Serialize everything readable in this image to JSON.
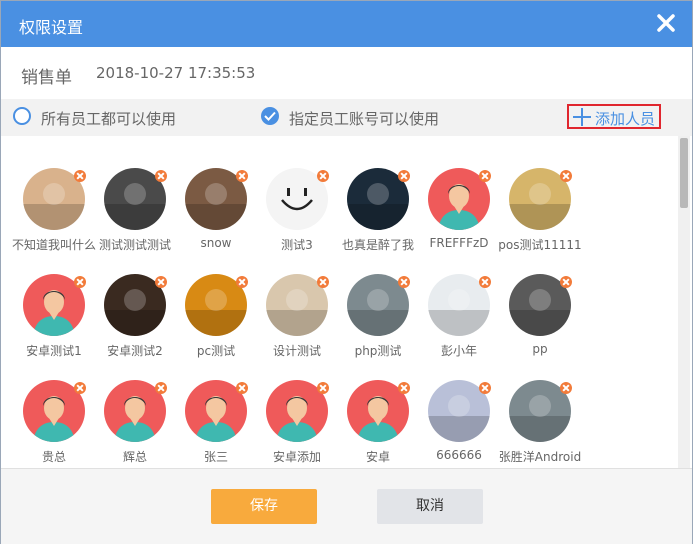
{
  "dialog": {
    "title": "权限设置",
    "close_icon": "close-icon",
    "accent": "#4a90e2"
  },
  "document": {
    "type": "销售单",
    "timestamp": "2018-10-27 17:35:53"
  },
  "options": {
    "all_employees": {
      "label": "所有员工都可以使用",
      "checked": false
    },
    "specified_employees": {
      "label": "指定员工账号可以使用",
      "checked": true
    },
    "add_member": {
      "label": "添加人员",
      "icon": "plus-icon"
    }
  },
  "members": [
    {
      "name": "不知道我叫什么",
      "avatar": "photo-crying-kid",
      "color": "#d9b28c"
    },
    {
      "name": "测试测试测试",
      "avatar": "photo-keyboard",
      "color": "#4a4a4a"
    },
    {
      "name": "snow",
      "avatar": "photo-bearded-man",
      "color": "#7b5a43"
    },
    {
      "name": "测试3",
      "avatar": "smiley-face",
      "color": "#f4f4f4"
    },
    {
      "name": "也真是醉了我",
      "avatar": "photo-dark-abstract",
      "color": "#1b2b3a"
    },
    {
      "name": "FREFFFzD",
      "avatar": "default-person",
      "color": "#ef5a5a"
    },
    {
      "name": "pos测试11111",
      "avatar": "photo-illustration",
      "color": "#d6b56a"
    },
    {
      "name": "安卓测试1",
      "avatar": "default-person",
      "color": "#ef5a5a"
    },
    {
      "name": "安卓测试2",
      "avatar": "photo-night-street",
      "color": "#3a2a20"
    },
    {
      "name": "pc测试",
      "avatar": "photo-crown",
      "color": "#d88a14"
    },
    {
      "name": "设计测试",
      "avatar": "photo-wood",
      "color": "#d9c7ad"
    },
    {
      "name": "php测试",
      "avatar": "photo-great-wall",
      "color": "#7d8a8f"
    },
    {
      "name": "彭小年",
      "avatar": "photo-document",
      "color": "#e8ecef"
    },
    {
      "name": "pp",
      "avatar": "photo-man-portrait",
      "color": "#5a5a5a"
    },
    {
      "name": "贵总",
      "avatar": "default-person",
      "color": "#ef5a5a"
    },
    {
      "name": "辉总",
      "avatar": "default-person",
      "color": "#ef5a5a"
    },
    {
      "name": "张三",
      "avatar": "default-person",
      "color": "#ef5a5a"
    },
    {
      "name": "安卓添加",
      "avatar": "default-person",
      "color": "#ef5a5a"
    },
    {
      "name": "安卓",
      "avatar": "default-person",
      "color": "#ef5a5a"
    },
    {
      "name": "666666",
      "avatar": "photo-couple",
      "color": "#b9c0d8"
    },
    {
      "name": "张胜洋Android",
      "avatar": "photo-great-wall",
      "color": "#7d8a8f"
    }
  ],
  "footer": {
    "save_label": "保存",
    "cancel_label": "取消",
    "save_color": "#f8aa3d"
  }
}
